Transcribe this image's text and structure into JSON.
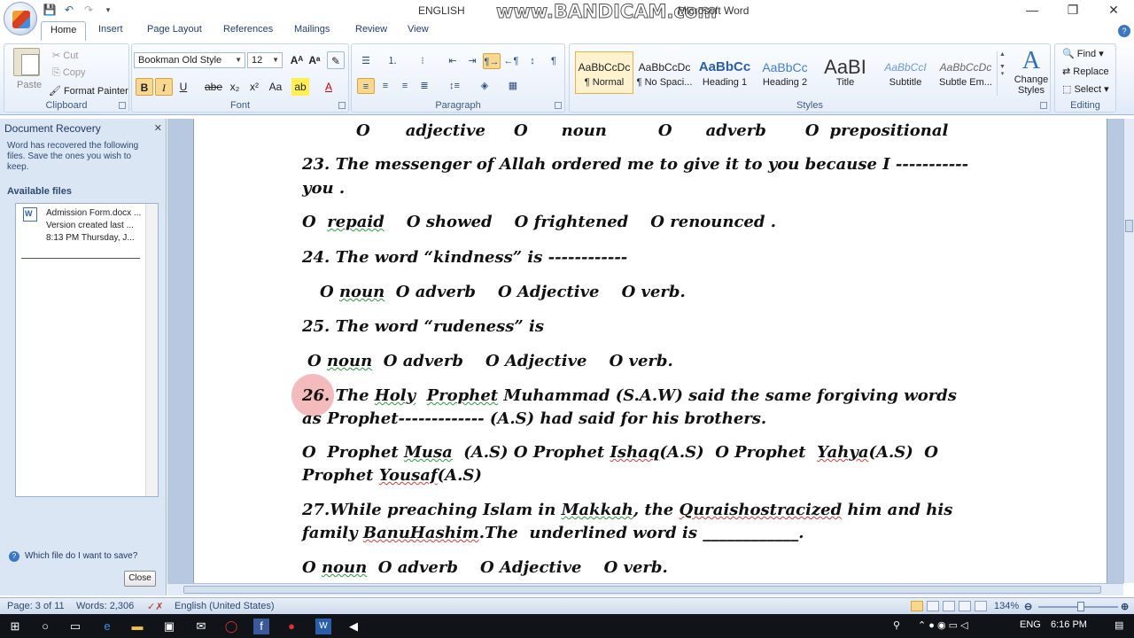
{
  "window": {
    "title_left": "ENGLISH ",
    "title_right": "Microsoft Word",
    "watermark": "www.BANDICAM.com",
    "controls": [
      "—",
      "❐",
      "✕"
    ]
  },
  "qat": {
    "save": "💾",
    "undo": "↶",
    "redo": "↷",
    "more": "▾"
  },
  "tabs": [
    "Home",
    "Insert",
    "Page Layout",
    "References",
    "Mailings",
    "Review",
    "View"
  ],
  "ribbon": {
    "clipboard": {
      "paste": "Paste",
      "cut": "Cut",
      "copy": "Copy",
      "format_painter": "Format Painter",
      "label": "Clipboard"
    },
    "font": {
      "name": "Bookman Old Style",
      "size": "12",
      "label": "Font"
    },
    "paragraph": {
      "label": "Paragraph"
    },
    "styles": {
      "label": "Styles",
      "items": [
        {
          "sample": "AaBbCcDc",
          "name": "¶ Normal"
        },
        {
          "sample": "AaBbCcDc",
          "name": "¶ No Spaci..."
        },
        {
          "sample": "AaBbCc",
          "name": "Heading 1"
        },
        {
          "sample": "AaBbCc",
          "name": "Heading 2"
        },
        {
          "sample": "AaBI",
          "name": "Title"
        },
        {
          "sample": "AaBbCcI",
          "name": "Subtitle"
        },
        {
          "sample": "AaBbCcDc",
          "name": "Subtle Em..."
        }
      ],
      "change_styles": "Change Styles"
    },
    "editing": {
      "find": "Find",
      "replace": "Replace",
      "select": "Select",
      "label": "Editing"
    }
  },
  "recovery": {
    "title": "Document Recovery",
    "desc": "Word has recovered the following files.  Save the ones you wish to keep.",
    "available": "Available files",
    "file": {
      "name": "Admission Form.docx ...",
      "version": "Version created last ...",
      "time": "8:13 PM Thursday, J..."
    },
    "which": "Which file do I want to save?",
    "close": "Close"
  },
  "document": {
    "l1": {
      "a": "O",
      "b": "adjective",
      "c": "O",
      "d": "noun",
      "e": "O",
      "f": "adverb",
      "g": "O",
      "h": "prepositional"
    },
    "l2": "23. The messenger of Allah ordered me to give it to you because I -----------",
    "l3": "you .",
    "l4": {
      "a": "O  ",
      "b": "repaid",
      "c": "    O showed    O frightened    O renounced ."
    },
    "l5": "24. The word “kindness” is ------------",
    "l6": {
      "a": "O ",
      "b": "noun",
      "c": "  O adverb    O Adjective    O verb."
    },
    "l7": "25. The word “rudeness” is",
    "l8": {
      "a": "O ",
      "b": "noun",
      "c": "  O adverb    O Adjective    O verb."
    },
    "l9": {
      "a": "26. The ",
      "b": "Holy",
      "c": "  ",
      "d": "Prophet",
      "e": " Muhammad (S.A.W) said the same forgiving words"
    },
    "l10": "as Prophet------------- (A.S) had said for his brothers.",
    "l11": {
      "a": "O  Prophet ",
      "b": "Musa",
      "c": "  (A.S) O Prophet ",
      "d": "Ishaq",
      "e": "(A.S)  O Prophet  ",
      "f": "Yahya",
      "g": "(A.S)  O"
    },
    "l12": {
      "a": "Prophet ",
      "b": "Yousaf",
      "c": "(A.S)"
    },
    "l13": {
      "a": "27.While preaching Islam in ",
      "b": "Makkah",
      "c": ", the ",
      "d": "Quraishostracized",
      "e": " him and his"
    },
    "l14": {
      "a": "family ",
      "b": "BanuHashim",
      "c": ".The  underlined word is ____________."
    },
    "l15": {
      "a": "O ",
      "b": "noun",
      "c": "  O adverb    O Adjective    O verb."
    }
  },
  "status": {
    "page": "Page: 3 of 11",
    "words": "Words: 2,306",
    "language": "English (United States)",
    "zoom": "134%"
  },
  "taskbar": {
    "lang": "ENG",
    "time": "6:16 PM"
  }
}
